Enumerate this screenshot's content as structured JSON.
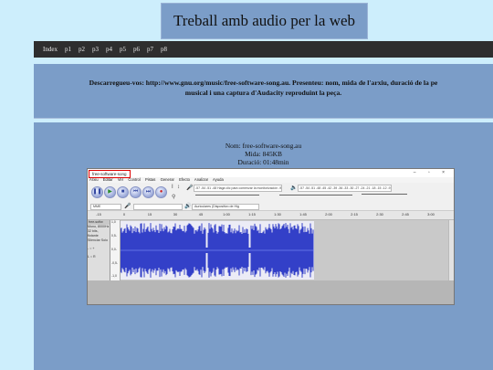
{
  "page": {
    "title": "Treball amb audio per la web"
  },
  "nav": {
    "items": [
      "Index",
      "p1",
      "p2",
      "p3",
      "p4",
      "p5",
      "p6",
      "p7",
      "p8"
    ]
  },
  "notice": {
    "line1": "Descarregueu-vos: http://www.gnu.org/music/free-software-song.au. Presenteu: nom, mida de l'arxiu, duració de la pe",
    "line2": "musical i una captura d'Audacity reproduint la peça."
  },
  "info": {
    "name": "Nom: free-software-song.au",
    "size": "Mida: 845KB",
    "duration": "Duració: 01:48min"
  },
  "audacity": {
    "window_title": "free-software-song",
    "window_controls": "– ▫ ×",
    "menu": [
      "Arxiu",
      "Editar",
      "Ver",
      "Control",
      "Pistas",
      "Generar",
      "Efecto",
      "Analizar",
      "Ayuda"
    ],
    "record_meter": "-57 -54 -51 -48 Haga clic para comenzar la monitorización -9 -6 -3 0",
    "play_meter": "-57 -54 -51 -48 -45 -42 -39 -36 -33 -30 -27 -24 -21 -18 -15 -12 -9 -6 -3 0",
    "host": "MME",
    "output_device": "Auriculares (Dispositivo de Hig",
    "ruler_ticks": [
      "-15",
      "0",
      "15",
      "30",
      "45",
      "1:00",
      "1:15",
      "1:30",
      "1:45",
      "2:00",
      "2:15",
      "2:30",
      "2:45",
      "3:00"
    ],
    "track": {
      "name": "free-softw",
      "info1": "Mono, 8000Hz",
      "info2": "32 bits, flotante",
      "info3": "Silenciar   Solo",
      "scale": [
        "1,0",
        "0,5-",
        "0,0-",
        "-0,5-",
        "-1,0"
      ]
    }
  },
  "colors": {
    "page_bg": "#cdeefc",
    "panel": "#7b9dc8",
    "nav_bg": "#2e2e2e",
    "waveform": "#3340c8"
  },
  "icons": [
    "pause-icon",
    "play-icon",
    "stop-icon",
    "skip-start-icon",
    "skip-end-icon",
    "record-icon",
    "selection-tool-icon",
    "envelope-tool-icon",
    "zoom-tool-icon",
    "microphone-icon",
    "speaker-icon"
  ]
}
